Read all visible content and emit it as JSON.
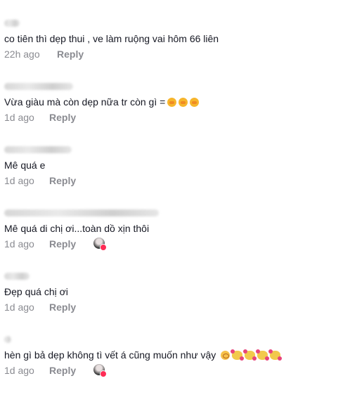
{
  "comments": [
    {
      "text": "co tiên thì dẹp thui , ve làm ruộng vai hôm 66 liên",
      "time": "22h ago",
      "reply_label": "Reply",
      "emojis": [],
      "liked_by_creator": false
    },
    {
      "text": "Vừa giàu mà còn dẹp nữa tr còn gì =",
      "time": "1d ago",
      "reply_label": "Reply",
      "emojis": [
        "yellow-laugh-icon",
        "yellow-laugh-icon",
        "yellow-laugh-icon"
      ],
      "liked_by_creator": false
    },
    {
      "text": "Mê quá e",
      "time": "1d ago",
      "reply_label": "Reply",
      "emojis": [],
      "liked_by_creator": false
    },
    {
      "text": "Mê quá di chị ơi...toàn dồ xịn thôi",
      "time": "1d ago",
      "reply_label": "Reply",
      "emojis": [],
      "liked_by_creator": true
    },
    {
      "text": "Đẹp quá chị ơi",
      "time": "1d ago",
      "reply_label": "Reply",
      "emojis": [],
      "liked_by_creator": false
    },
    {
      "text": "hèn gì bả dẹp không tì vết á cũng muốn như vậy",
      "time": "1d ago",
      "reply_label": "Reply",
      "emojis": [
        "blush-face-icon",
        "smiling-face-with-hearts-icon",
        "smiling-face-with-hearts-icon",
        "smiling-face-with-hearts-icon",
        "smiling-face-with-hearts-icon"
      ],
      "liked_by_creator": true
    }
  ],
  "colors": {
    "text": "#161823",
    "meta": "#8a8b91",
    "accent": "#fe2c55"
  }
}
